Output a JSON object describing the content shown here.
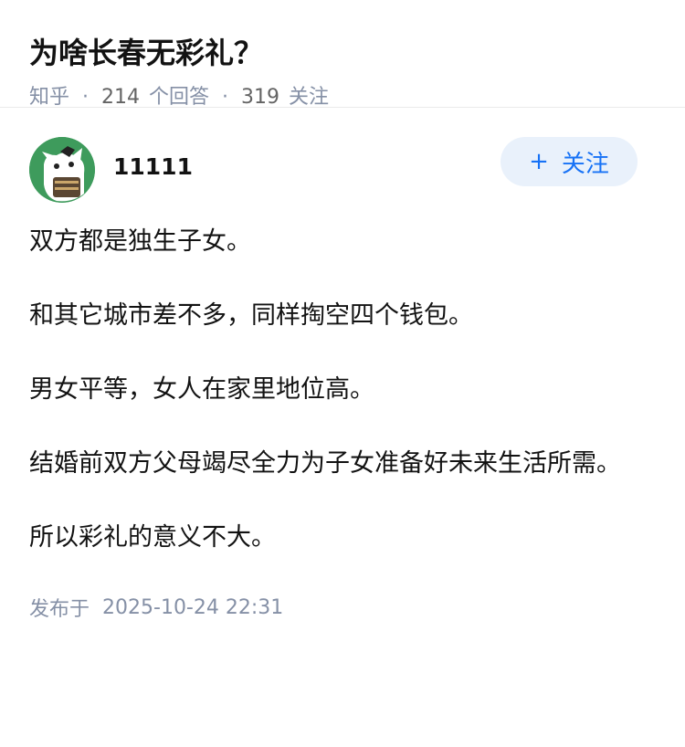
{
  "question": {
    "title": "为啥长春无彩礼？",
    "source": "知乎",
    "dot": "·",
    "answer_count": "214",
    "answer_label": "个回答",
    "follow_count": "319",
    "follow_label": "关注"
  },
  "answer": {
    "author": {
      "name": "11111",
      "avatar_icon": "avatar-cartoon-icon"
    },
    "follow_button": {
      "icon": "plus-icon",
      "plus": "+",
      "label": "关注"
    },
    "paragraphs": [
      "双方都是独生子女。",
      "和其它城市差不多，同样掏空四个钱包。",
      "男女平等，女人在家里地位高。",
      "结婚前双方父母竭尽全力为子女准备好未来生活所需。",
      "所以彩礼的意义不大。"
    ],
    "publish_label": "发布于",
    "publish_time": "2025-10-24 22:31"
  },
  "colors": {
    "accent": "#1772f6",
    "follow_bg": "#e9f1fb",
    "meta_text": "#8590a6",
    "avatar_bg": "#3e9b5c"
  }
}
